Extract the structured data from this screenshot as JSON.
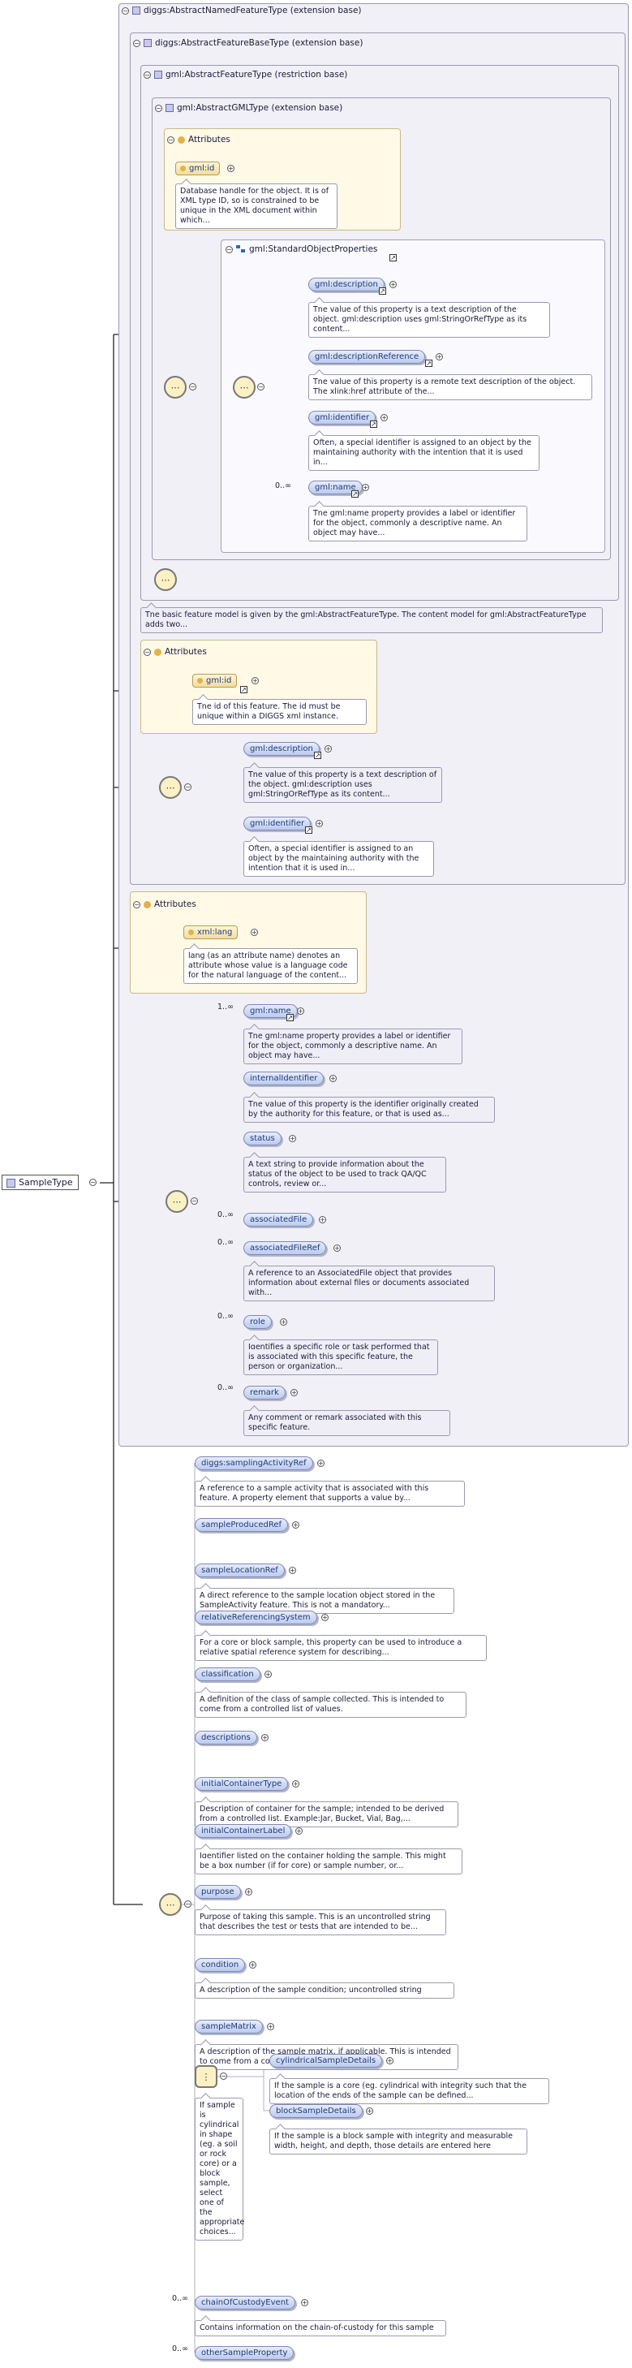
{
  "root": {
    "name": "SampleType"
  },
  "types": {
    "named_feature": "diggs:AbstractNamedFeatureType (extension base)",
    "feature_base": "diggs:AbstractFeatureBaseType (extension base)",
    "gml_feature": "gml:AbstractFeatureType (restriction base)",
    "gml_gml": "gml:AbstractGMLType (extension base)",
    "std_props": "gml:StandardObjectProperties"
  },
  "attributes_label": "Attributes",
  "gml_attr": {
    "name": "gml:id",
    "doc": "Database handle for the object. It is of XML type ID, so is constrained to be unique in the XML document within which..."
  },
  "std_elements": [
    {
      "name": "gml:description",
      "doc": "The value of this property is a text description of the object. gml:description uses gml:StringOrRefType as its content..."
    },
    {
      "name": "gml:descriptionReference",
      "doc": "The value of this property is a remote text description of the object. The xlink:href attribute of the..."
    },
    {
      "name": "gml:identifier",
      "doc": "Often, a special identifier is assigned to an object by the maintaining authority with the intention that it is used in..."
    },
    {
      "name": "gml:name",
      "mult": "0..∞",
      "doc": "The gml:name property provides a label or identifier for the object, commonly a descriptive name. An object may have..."
    }
  ],
  "feature_doc": "The basic feature model is given by the gml:AbstractFeatureType. The content model for gml:AbstractFeatureType adds two...",
  "base_attr": {
    "name": "gml:id",
    "doc": "The id of this feature. The id must be unique within a DIGGS xml instance."
  },
  "base_elements": [
    {
      "name": "gml:description",
      "doc": "The value of this property is a text description of the object. gml:description uses gml:StringOrRefType as its content..."
    },
    {
      "name": "gml:identifier",
      "doc": "Often, a special identifier is assigned to an object by the maintaining authority with the intention that it is used in..."
    }
  ],
  "lang_attr": {
    "name": "xml:lang",
    "doc": "lang (as an attribute name) denotes an attribute whose value is a language code for the natural language of the content..."
  },
  "named_elements": [
    {
      "name": "gml:name",
      "mult": "1..∞",
      "doc": "The gml:name property provides a label or identifier for the object, commonly a descriptive name. An object may have..."
    },
    {
      "name": "internalIdentifier",
      "mult": "",
      "doc": "The value of this property is the identifier originally created by the authority for this feature, or that is used as..."
    },
    {
      "name": "status",
      "mult": "",
      "doc": "A text string to provide information about the status of the object to be used to track QA/QC controls, review or..."
    },
    {
      "name": "associatedFile",
      "mult": "0..∞",
      "doc": ""
    },
    {
      "name": "associatedFileRef",
      "mult": "0..∞",
      "doc": "A reference to an AssociatedFile object that provides information about external files or documents associated with..."
    },
    {
      "name": "role",
      "mult": "0..∞",
      "doc": "Identifies a specific role or task performed that is associated with this specific feature, the person or organization..."
    },
    {
      "name": "remark",
      "mult": "0..∞",
      "doc": "Any comment or remark associated with this specific feature."
    }
  ],
  "sample_elements": [
    {
      "name": "diggs:samplingActivityRef",
      "doc": "A reference to a sample activity that is associated with this feature. A property element that supports a value by..."
    },
    {
      "name": "sampleProducedRef",
      "doc": ""
    },
    {
      "name": "sampleLocationRef",
      "doc": "A direct reference to the sample location object stored in the SampleActivity feature. This is not a mandatory..."
    },
    {
      "name": "relativeReferencingSystem",
      "doc": "For a core or block sample, this property can be used to introduce a relative spatial reference system for describing..."
    },
    {
      "name": "classification",
      "doc": "A definition of the class of sample collected. This is intended to come from a controlled list of values."
    },
    {
      "name": "descriptions",
      "doc": ""
    },
    {
      "name": "initialContainerType",
      "doc": "Description of container for the sample; intended to be derived from a controlled list. Example:Jar, Bucket, Vial, Bag,..."
    },
    {
      "name": "initialContainerLabel",
      "doc": "Identifier listed on the container holding the sample. This might be a box number (if for core) or sample number, or..."
    },
    {
      "name": "purpose",
      "doc": "Purpose of taking this sample. This is an uncontrolled string that describes the test or tests that are intended to be..."
    },
    {
      "name": "condition",
      "doc": "A description of the sample condition; uncontrolled string"
    },
    {
      "name": "sampleMatrix",
      "doc": "A description of the sample matrix, if applicable. This is intended to come from a controlled list."
    }
  ],
  "choice": {
    "doc": "If sample is cylindrical in shape (eg. a soil or rock core) or a block sample, select one of the appropriate choices...",
    "options": [
      {
        "name": "cylindricalSampleDetails",
        "doc": "If the sample is a core (eg. cylindrical with integrity such that the location of the ends of the sample can be defined..."
      },
      {
        "name": "blockSampleDetails",
        "doc": "If the sample is a block sample with integrity and measurable width, height, and depth, those details are entered here"
      }
    ]
  },
  "tail_elements": [
    {
      "name": "chainOfCustodyEvent",
      "mult": "0..∞",
      "doc": "Contains information on the chain-of-custody for this sample"
    },
    {
      "name": "otherSampleProperty",
      "mult": "0..∞",
      "doc": ""
    }
  ]
}
